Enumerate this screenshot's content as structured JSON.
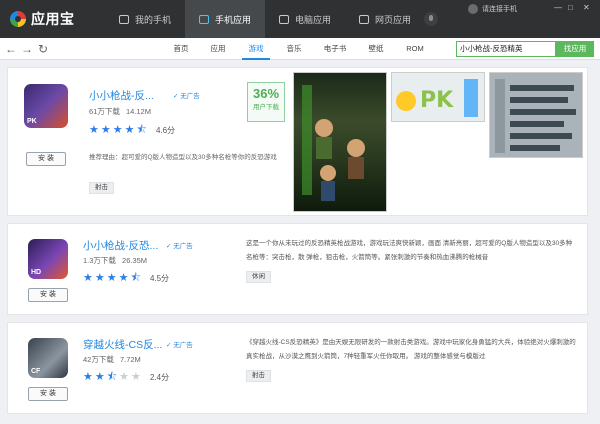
{
  "app": {
    "name": "应用宝"
  },
  "tabs": [
    {
      "label": "我的手机"
    },
    {
      "label": "手机应用"
    },
    {
      "label": "电脑应用"
    },
    {
      "label": "网页应用"
    }
  ],
  "user": {
    "label": "请连接手机"
  },
  "window_controls": [
    "—",
    "□",
    "✕"
  ],
  "nav": {
    "back": "←",
    "forward": "→",
    "refresh": "↻"
  },
  "categories": [
    "首页",
    "应用",
    "游戏",
    "音乐",
    "电子书",
    "壁纸",
    "ROM"
  ],
  "active_category": "游戏",
  "search": {
    "value": "小小枪战-反恐精英",
    "button": "找应用"
  },
  "apps": [
    {
      "title": "小小枪战-反...",
      "no_ads": "无广告",
      "downloads": "61万下载",
      "size": "14.12M",
      "rating": 4.5,
      "score": "4.6分",
      "install": "安 装",
      "recommend": "推荐理由：超可爱的Q版人物造型以及30多种名枪等你的反恐游戏",
      "tag": "射击",
      "percent": "36%",
      "percent_label": "用户下载",
      "icon_badge": "PK",
      "icon": "soldier-game-icon"
    },
    {
      "title": "小小枪战-反恐...",
      "no_ads": "无广告",
      "downloads": "1.3万下载",
      "size": "26.35M",
      "rating": 4.5,
      "score": "4.5分",
      "install": "安 装",
      "description": "这是一个你从未玩过的反恐精英枪战游戏，游戏玩法爽快新颖，画面 清新亮丽，超可爱的Q版人物造型以及30多种名枪等：突击枪，散 弹枪，狙击枪，火箭筒等。紧张刺激的节奏和热血沸腾的枪械音",
      "tag": "休闲",
      "icon_badge": "HD",
      "icon": "soldier-game-icon"
    },
    {
      "title": "穿越火线-CS反...",
      "no_ads": "无广告",
      "downloads": "42万下载",
      "size": "7.72M",
      "rating": 2.5,
      "score": "2.4分",
      "install": "安 装",
      "description": "《穿越火线-CS反恐精英》是由天娱无限研发的一款射击类游戏。游戏中玩家化身勇猛的大兵，体验绝对火爆刺激的真实枪战，从沙漠之鹰到火箭筒，7种轻重军火任你取用。 游戏的整体感觉与模版过",
      "tag": "射击",
      "icon_badge": "CF",
      "icon": "soldier-game-icon"
    }
  ]
}
